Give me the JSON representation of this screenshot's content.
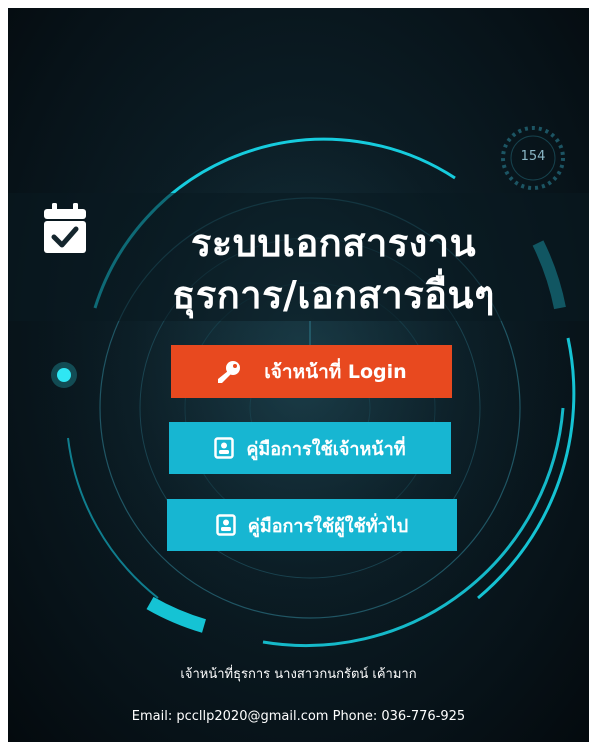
{
  "counter": "154",
  "title": {
    "line1": "ระบบเอกสารงาน",
    "line2": "ธุรการ/เอกสารอื่นๆ"
  },
  "buttons": {
    "login_label": "เจ้าหน้าที่ Login",
    "staff_manual_label": "คู่มือการใช้เจ้าหน้าที่",
    "public_manual_label": "คู่มือการใช้ผู้ใช้ทั่วไป"
  },
  "footer": {
    "name_line": "เจ้าหน้าที่ธุรการ นางสาวกนกรัตน์ เค้ามาก",
    "contact_line": "Email: pccllp2020@gmail.com Phone: 036-776-925"
  },
  "colors": {
    "login_button": "#e8491f",
    "manual_button": "#17b6d2",
    "ring_accent": "#17d6e8",
    "background": "#0b1c24"
  },
  "icons": {
    "title": "calendar-check-icon",
    "login": "key-icon",
    "manual": "contact-card-icon"
  }
}
